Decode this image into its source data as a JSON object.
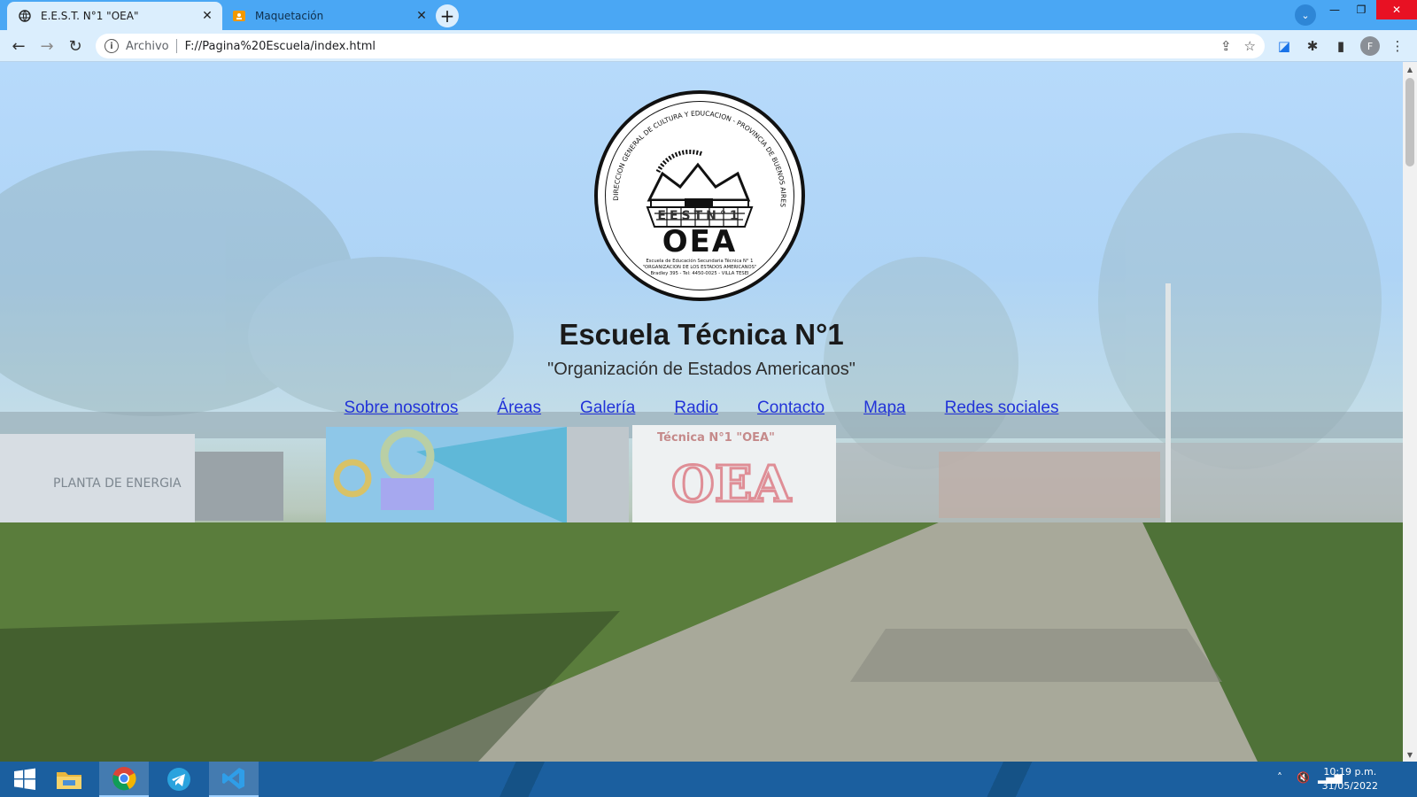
{
  "browser": {
    "tabs": [
      {
        "title": "E.E.S.T. N°1 \"OEA\"",
        "icon": "globe-icon",
        "active": true
      },
      {
        "title": "Maquetación",
        "icon": "slides-icon",
        "active": false
      }
    ],
    "address": {
      "scheme_label": "Archivo",
      "url": "F://Pagina%20Escuela/index.html"
    },
    "profile_initial": "F"
  },
  "page": {
    "logo": {
      "ring_text": "DIRECCION GENERAL DE CULTURA Y EDUCACION - PROVINCIA DE BUENOS AIRES",
      "label": "EESTN°1",
      "big": "OEA",
      "line1": "Escuela de Educación Secundaria Técnica N° 1",
      "line2": "\"ORGANIZACION DE LOS ESTADOS AMERICANOS\"",
      "line3": "Bradley 395 - Tel: 4450-0025 - VILLA TESEI"
    },
    "title": "Escuela Técnica N°1",
    "subtitle": "\"Organización de Estados Americanos\"",
    "nav": [
      "Sobre nosotros",
      "Áreas",
      "Galería",
      "Radio",
      "Contacto",
      "Mapa",
      "Redes sociales"
    ],
    "background_mural": {
      "sign_top": "Técnica N°1 \"OEA\"",
      "graffiti": "OEA"
    }
  },
  "taskbar": {
    "apps": [
      "windows-start-icon",
      "file-explorer-icon",
      "chrome-icon",
      "telegram-icon",
      "vscode-icon"
    ],
    "time": "10:19 p.m.",
    "date": "31/05/2022"
  },
  "colors": {
    "tabstrip": "#4aa7f4",
    "toolbar": "#dbeefd",
    "link": "#2233d8",
    "close": "#e81123"
  }
}
